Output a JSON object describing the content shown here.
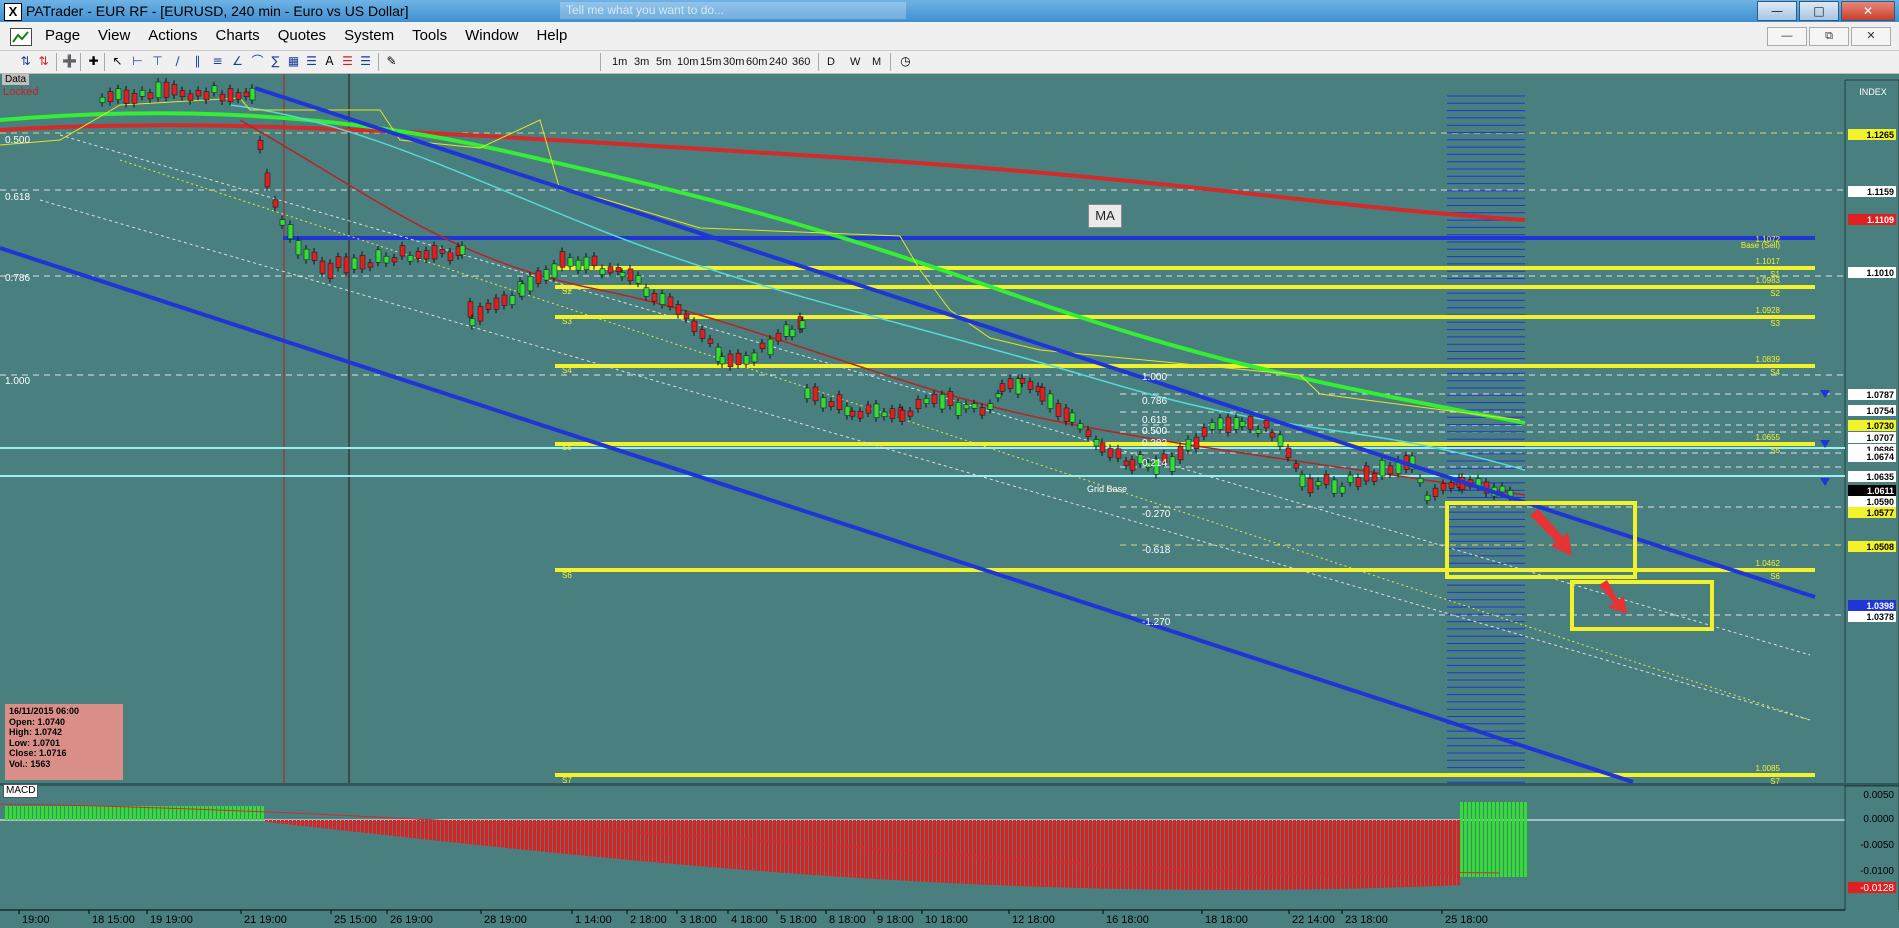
{
  "window": {
    "title": "PATrader - EUR RF - [EURUSD, 240 min - Euro vs US Dollar]",
    "search_placeholder": "Tell me what you want to do...",
    "app_icon_letter": "X"
  },
  "menu": [
    "Page",
    "View",
    "Actions",
    "Charts",
    "Quotes",
    "System",
    "Tools",
    "Window",
    "Help"
  ],
  "timeframes": [
    "1m",
    "3m",
    "5m",
    "10m",
    "15m",
    "30m",
    "60m",
    "240",
    "360",
    "D",
    "W",
    "M"
  ],
  "chart": {
    "data_tab": "Data",
    "locked": "Locked",
    "ma_button": "MA",
    "index_label": "INDEX",
    "macd_label": "MACD",
    "fib_left": [
      "0.500",
      "0.618",
      "0.786",
      "1.000"
    ],
    "fib_center": [
      "1.000",
      "0.786",
      "0.618",
      "0.500",
      "0.382",
      "0.214",
      "-0.270",
      "-0.618",
      "-1.270"
    ],
    "pivot_labels": [
      "Base (Sell)",
      "S1",
      "S2",
      "S3",
      "S4",
      "S5",
      "S6",
      "S7"
    ],
    "pivot_values": [
      "1.1072",
      "1.1017",
      "1.0983",
      "1.0928",
      "1.0839",
      "1.0655",
      "1.0462",
      "1.0085"
    ],
    "grid_base_label": "Grid Base",
    "price_labels": [
      "1.1265",
      "1.1159",
      "1.1109",
      "1.1010",
      "1.0787",
      "1.0754",
      "1.0730",
      "1.0707",
      "1.0686",
      "1.0674",
      "1.0635",
      "1.0611",
      "1.0590",
      "1.0577",
      "1.0508",
      "1.0398",
      "1.0378"
    ],
    "macd_scale": [
      "0.0050",
      "0.0000",
      "-0.0050",
      "-0.0100",
      "-0.0128"
    ],
    "time_labels": [
      "19:00",
      "18 15:00",
      "19 19:00",
      "21 19:00",
      "25 15:00",
      "26 19:00",
      "28 19:00",
      "1 14:00",
      "2 18:00",
      "3 18:00",
      "4 18:00",
      "5 18:00",
      "8 18:00",
      "9 18:00",
      "10 18:00",
      "12 18:00",
      "16 18:00",
      "18 18:00",
      "22 14:00",
      "23 18:00",
      "25 18:00"
    ]
  },
  "info_box": {
    "date": "16/11/2015 06:00",
    "open": "Open: 1.0740",
    "high": "High: 1.0742",
    "low": "Low: 1.0701",
    "close": "Close: 1.0716",
    "vol": "Vol.: 1563"
  },
  "colors": {
    "background": "#4a7f7f",
    "channel": "#1f35d6",
    "pivot": "#f2f22a",
    "ma_green": "#33ee33",
    "ma_red": "#d42a2a",
    "bull": "#33dd33",
    "bear": "#e02020"
  }
}
